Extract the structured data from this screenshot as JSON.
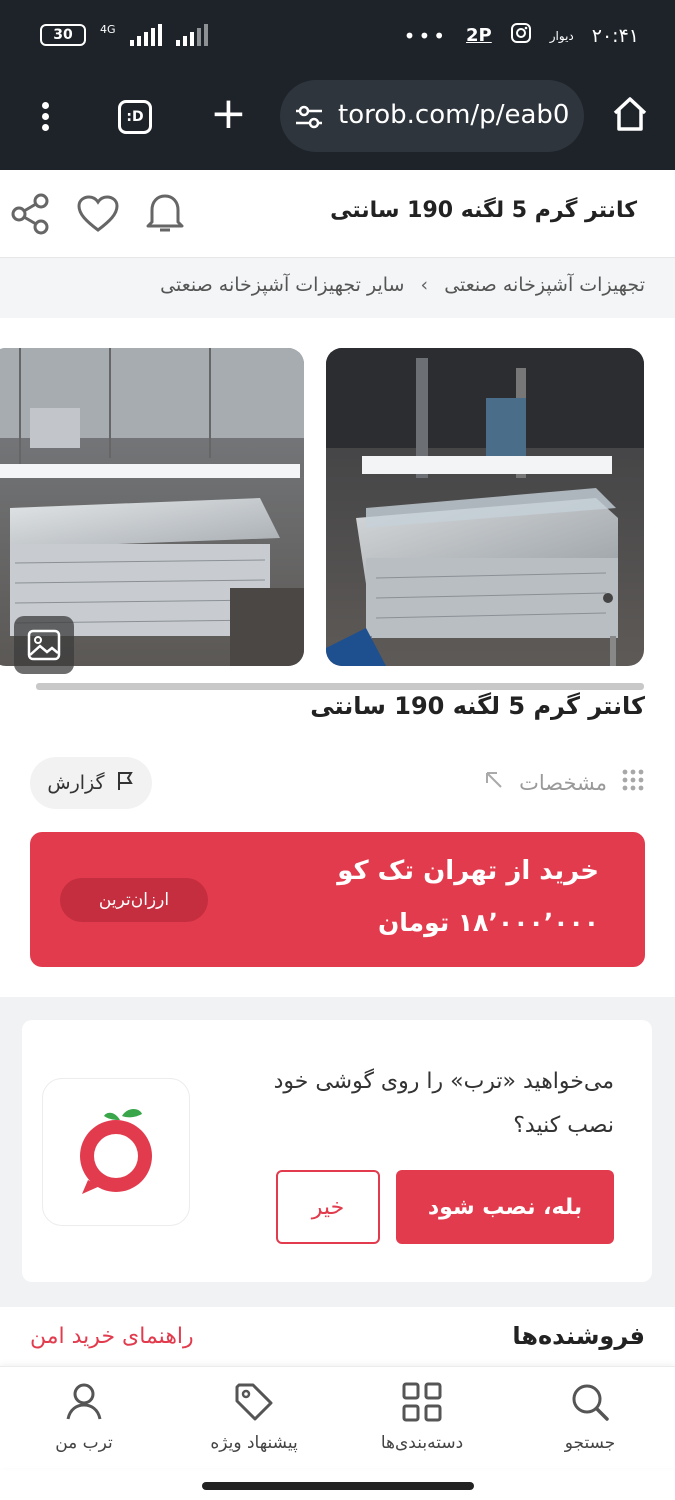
{
  "status_bar": {
    "time": "۲۰:۴۱",
    "carrier_small": "دیوار",
    "battery": "30",
    "network": "4G",
    "dots": "•••",
    "two_p": "2P"
  },
  "browser": {
    "url": "torob.com/p/eab0",
    "tab_label": ":D"
  },
  "product_header": {
    "title": "کانتر گرم 5 لگنه 190 سانتی"
  },
  "breadcrumb": {
    "items": [
      "تجهیزات آشپزخانه صنعتی",
      "سایر تجهیزات آشپزخانه صنعتی"
    ],
    "separator": "›"
  },
  "product": {
    "title": "کانتر گرم 5 لگنه 190 سانتی",
    "specs_label": "مشخصات",
    "report_label": "گزارش"
  },
  "offer": {
    "store_line": "خرید از تهران تک کو",
    "price_line": "۱۸٬۰۰۰٬۰۰۰ تومان",
    "badge": "ارزان‌ترین"
  },
  "app_promo": {
    "text": "می‌خواهید «ترب» را روی گوشی خود نصب کنید؟",
    "yes_label": "بله، نصب شود",
    "no_label": "خیر"
  },
  "sellers": {
    "title": "فروشنده‌ها",
    "guide_link": "راهنمای خرید امن"
  },
  "bottom_nav": {
    "search": "جستجو",
    "categories": "دسته‌بندی‌ها",
    "offers": "پیشنهاد ویژه",
    "profile": "ترب من"
  },
  "colors": {
    "accent": "#e23b4d",
    "dark_bar": "#1d2329"
  }
}
